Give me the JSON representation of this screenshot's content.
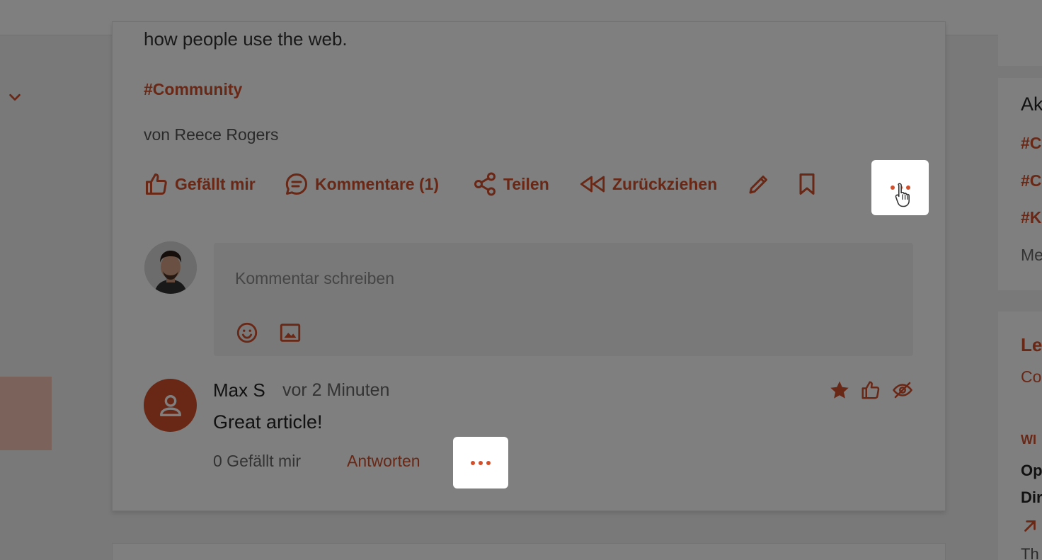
{
  "post": {
    "text_fragment": "how people use the web.",
    "hashtag": "#Community",
    "author_line": "von Reece Rogers"
  },
  "actions": {
    "like": "Gefällt mir",
    "comments": "Kommentare (1)",
    "share": "Teilen",
    "withdraw": "Zurückziehen"
  },
  "composer": {
    "placeholder": "Kommentar schreiben"
  },
  "comment": {
    "author": "Max S",
    "time": "vor 2 Minuten",
    "text": "Great article!",
    "likes": "0 Gefällt mir",
    "reply": "Antworten"
  },
  "right_sidebar": {
    "heading_fragment": "Ak",
    "tags": [
      "#C",
      "#C",
      "#K"
    ],
    "more_fragment": "Me",
    "link_fragment": "Le",
    "sub_fragment": "Co",
    "caps_fragment": "WI",
    "bold_1": "Op",
    "bold_2": "Dir",
    "text_fragment": "Th"
  },
  "colors": {
    "accent": "#d24f2c",
    "overlay": "rgba(0,0,0,0.5)"
  }
}
